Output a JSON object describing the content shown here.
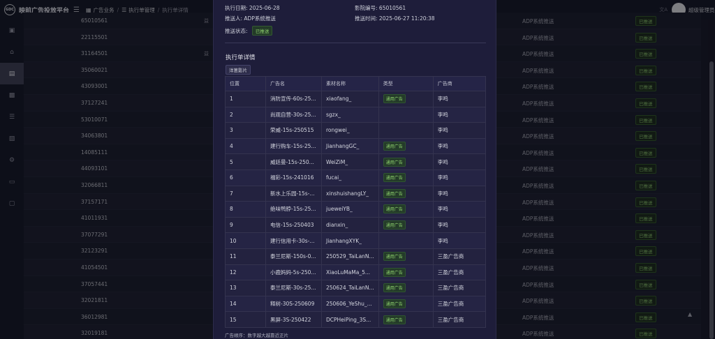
{
  "header": {
    "logo_abbr": "GDC",
    "app_title": "映前广告投放平台",
    "breadcrumbs": [
      "广告业务",
      "执行单管理",
      "执行单详情"
    ],
    "user_name": "超级管理员"
  },
  "sidebar": {
    "items": [
      {
        "icon": "document-icon",
        "active": false
      },
      {
        "icon": "home-icon",
        "active": false
      },
      {
        "icon": "monitor-icon",
        "active": true
      },
      {
        "icon": "bar-chart-icon",
        "active": false
      },
      {
        "icon": "list-icon",
        "active": false
      },
      {
        "icon": "clipboard-icon",
        "active": false
      },
      {
        "icon": "gear-icon",
        "active": false
      },
      {
        "icon": "trash-icon",
        "active": false
      },
      {
        "icon": "screen-icon",
        "active": false
      }
    ]
  },
  "background_table": {
    "rows": [
      {
        "id": "65010561",
        "sub": "益",
        "method": "ADP系统推送",
        "status": "已推送"
      },
      {
        "id": "22115501",
        "sub": "",
        "method": "ADP系统推送",
        "status": "已推送"
      },
      {
        "id": "31164501",
        "sub": "益",
        "method": "ADP系统推送",
        "status": "已推送"
      },
      {
        "id": "35060021",
        "sub": "",
        "method": "ADP系统推送",
        "status": "已推送"
      },
      {
        "id": "43093001",
        "sub": "",
        "method": "ADP系统推送",
        "status": "已推送"
      },
      {
        "id": "37127241",
        "sub": "",
        "method": "ADP系统推送",
        "status": "已推送"
      },
      {
        "id": "53010071",
        "sub": "",
        "method": "ADP系统推送",
        "status": "已推送"
      },
      {
        "id": "34063801",
        "sub": "",
        "method": "ADP系统推送",
        "status": "已推送"
      },
      {
        "id": "14085111",
        "sub": "",
        "method": "ADP系统推送",
        "status": "已推送"
      },
      {
        "id": "44093101",
        "sub": "",
        "method": "ADP系统推送",
        "status": "已推送"
      },
      {
        "id": "32066811",
        "sub": "",
        "method": "ADP系统推送",
        "status": "已推送"
      },
      {
        "id": "37157171",
        "sub": "",
        "method": "ADP系统推送",
        "status": "已推送"
      },
      {
        "id": "41011931",
        "sub": "",
        "method": "ADP系统推送",
        "status": "已推送"
      },
      {
        "id": "37077291",
        "sub": "",
        "method": "ADP系统推送",
        "status": "已推送"
      },
      {
        "id": "32123291",
        "sub": "",
        "method": "ADP系统推送",
        "status": "已推送"
      },
      {
        "id": "41054501",
        "sub": "",
        "method": "ADP系统推送",
        "status": "已推送"
      },
      {
        "id": "37057441",
        "sub": "",
        "method": "ADP系统推送",
        "status": "已推送"
      },
      {
        "id": "32021811",
        "sub": "",
        "method": "ADP系统推送",
        "status": "已推送"
      },
      {
        "id": "36012981",
        "sub": "",
        "method": "ADP系统推送",
        "status": "已推送"
      },
      {
        "id": "32019181",
        "sub": "",
        "method": "ADP系统推送",
        "status": "已推送"
      }
    ]
  },
  "detail": {
    "exec_date_label": "执行日期:",
    "exec_date": "2025-06-28",
    "cinema_code_label": "影院编号:",
    "cinema_code": "65010561",
    "pusher_label": "推送人:",
    "pusher": "ADP系统推送",
    "push_time_label": "推送时间:",
    "push_time": "2025-06-27 11:20:38",
    "push_status_label": "推送状态:",
    "push_status": "已推送",
    "section_title": "执行单详情",
    "section_button": "洋葱影片",
    "columns": [
      "位置",
      "广告名",
      "素材名称",
      "类型",
      "广告商"
    ],
    "rows": [
      {
        "pos": "1",
        "ad": "消防宣传-60s-25...",
        "material": "xiaofang_",
        "type": "通用广告",
        "advertiser": "李鸣"
      },
      {
        "pos": "2",
        "ad": "尚观自营-30s-25...",
        "material": "sgzx_",
        "type": "",
        "advertiser": "李鸣"
      },
      {
        "pos": "3",
        "ad": "荣威-15s-250515",
        "material": "rongwei_",
        "type": "",
        "advertiser": "李鸣"
      },
      {
        "pos": "4",
        "ad": "建行购车-15s-25...",
        "material": "JianhangGC_",
        "type": "通用广告",
        "advertiser": "李鸣"
      },
      {
        "pos": "5",
        "ad": "威廷曼-15s-250...",
        "material": "WeiZiM_",
        "type": "通用广告",
        "advertiser": "李鸣"
      },
      {
        "pos": "6",
        "ad": "福彩-15s-241016",
        "material": "fucai_",
        "type": "通用广告",
        "advertiser": "李鸣"
      },
      {
        "pos": "7",
        "ad": "新水上乐园-15s-...",
        "material": "xinshuishangLY_",
        "type": "通用广告",
        "advertiser": "李鸣"
      },
      {
        "pos": "8",
        "ad": "绝味鸭脖-15s-25...",
        "material": "jueweiYB_",
        "type": "通用广告",
        "advertiser": "李鸣"
      },
      {
        "pos": "9",
        "ad": "电信-15s-250403",
        "material": "dianxin_",
        "type": "通用广告",
        "advertiser": "李鸣"
      },
      {
        "pos": "10",
        "ad": "建行信用卡-30s-...",
        "material": "JianhangXYK_",
        "type": "",
        "advertiser": "李鸣"
      },
      {
        "pos": "11",
        "ad": "泰兰尼斯-150s-0...",
        "material": "250529_TaiLanN...",
        "type": "通用广告",
        "advertiser": "三盈广告商"
      },
      {
        "pos": "12",
        "ad": "小鹿妈妈-5s-250...",
        "material": "XiaoLuMaMa_5...",
        "type": "通用广告",
        "advertiser": "三盈广告商"
      },
      {
        "pos": "13",
        "ad": "泰兰尼斯-30s-25...",
        "material": "250624_TaiLanN...",
        "type": "通用广告",
        "advertiser": "三盈广告商"
      },
      {
        "pos": "14",
        "ad": "释树-30S-250609",
        "material": "250606_YeShu_...",
        "type": "通用广告",
        "advertiser": "三盈广告商"
      },
      {
        "pos": "15",
        "ad": "黑屏-3S-250422",
        "material": "DCPHeiPing_3S...",
        "type": "通用广告",
        "advertiser": "三盈广告商"
      }
    ],
    "footer_note": "广告顺序：数字越大越靠近正片"
  }
}
